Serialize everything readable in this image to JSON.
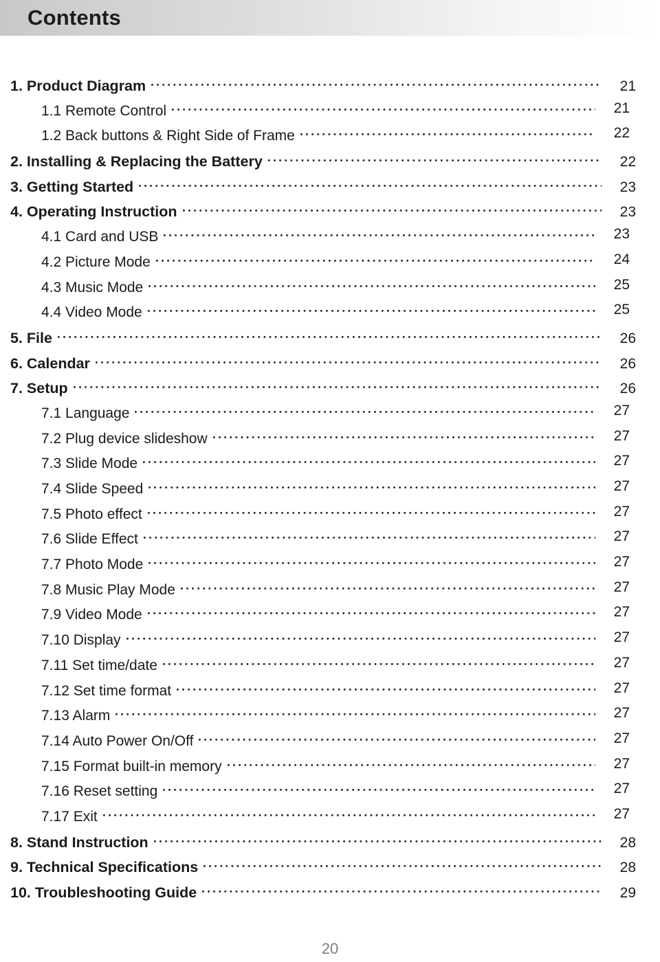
{
  "page": {
    "title": "Contents",
    "footer_page_number": "20",
    "accent_header_gradient_start": "#c6c8ca",
    "accent_header_gradient_end": "#ffffff",
    "text_color": "#1a1a1a",
    "footer_color": "#7d7d7d"
  },
  "toc": {
    "entries": [
      {
        "label": "1. Product Diagram",
        "page": "21",
        "level": 1
      },
      {
        "label": "1.1 Remote Control",
        "page": "21",
        "level": 2
      },
      {
        "label": "1.2 Back buttons & Right Side of Frame",
        "page": "22",
        "level": 2
      },
      {
        "label": "2. Installing & Replacing the Battery",
        "page": "22",
        "level": 1
      },
      {
        "label": "3. Getting Started",
        "page": "23",
        "level": 1
      },
      {
        "label": "4. Operating Instruction",
        "page": "23",
        "level": 1
      },
      {
        "label": "4.1 Card and USB",
        "page": "23",
        "level": 2
      },
      {
        "label": "4.2 Picture Mode",
        "page": "24",
        "level": 2
      },
      {
        "label": "4.3 Music Mode",
        "page": "25",
        "level": 2
      },
      {
        "label": "4.4 Video Mode",
        "page": "25",
        "level": 2
      },
      {
        "label": "5. File",
        "page": "26",
        "level": 1
      },
      {
        "label": "6. Calendar",
        "page": "26",
        "level": 1
      },
      {
        "label": "7. Setup",
        "page": "26",
        "level": 1
      },
      {
        "label": "7.1 Language",
        "page": "27",
        "level": 2
      },
      {
        "label": "7.2 Plug device slideshow",
        "page": "27",
        "level": 2
      },
      {
        "label": "7.3 Slide Mode",
        "page": "27",
        "level": 2
      },
      {
        "label": "7.4 Slide Speed",
        "page": "27",
        "level": 2
      },
      {
        "label": "7.5 Photo effect",
        "page": "27",
        "level": 2
      },
      {
        "label": "7.6 Slide Effect",
        "page": "27",
        "level": 2
      },
      {
        "label": "7.7 Photo Mode",
        "page": "27",
        "level": 2
      },
      {
        "label": "7.8 Music Play Mode",
        "page": "27",
        "level": 2
      },
      {
        "label": "7.9 Video Mode",
        "page": "27",
        "level": 2
      },
      {
        "label": "7.10 Display",
        "page": "27",
        "level": 2
      },
      {
        "label": "7.11 Set time/date",
        "page": "27",
        "level": 2
      },
      {
        "label": "7.12 Set time format",
        "page": "27",
        "level": 2
      },
      {
        "label": "7.13 Alarm",
        "page": "27",
        "level": 2
      },
      {
        "label": "7.14 Auto Power On/Off",
        "page": "27",
        "level": 2
      },
      {
        "label": "7.15 Format built-in memory",
        "page": "27",
        "level": 2
      },
      {
        "label": "7.16 Reset setting",
        "page": "27",
        "level": 2
      },
      {
        "label": "7.17 Exit",
        "page": "27",
        "level": 2
      },
      {
        "label": "8. Stand Instruction",
        "page": "28",
        "level": 1
      },
      {
        "label": "9. Technical Specifications",
        "page": "28",
        "level": 1
      },
      {
        "label": "10. Troubleshooting Guide",
        "page": "29",
        "level": 1
      }
    ]
  }
}
